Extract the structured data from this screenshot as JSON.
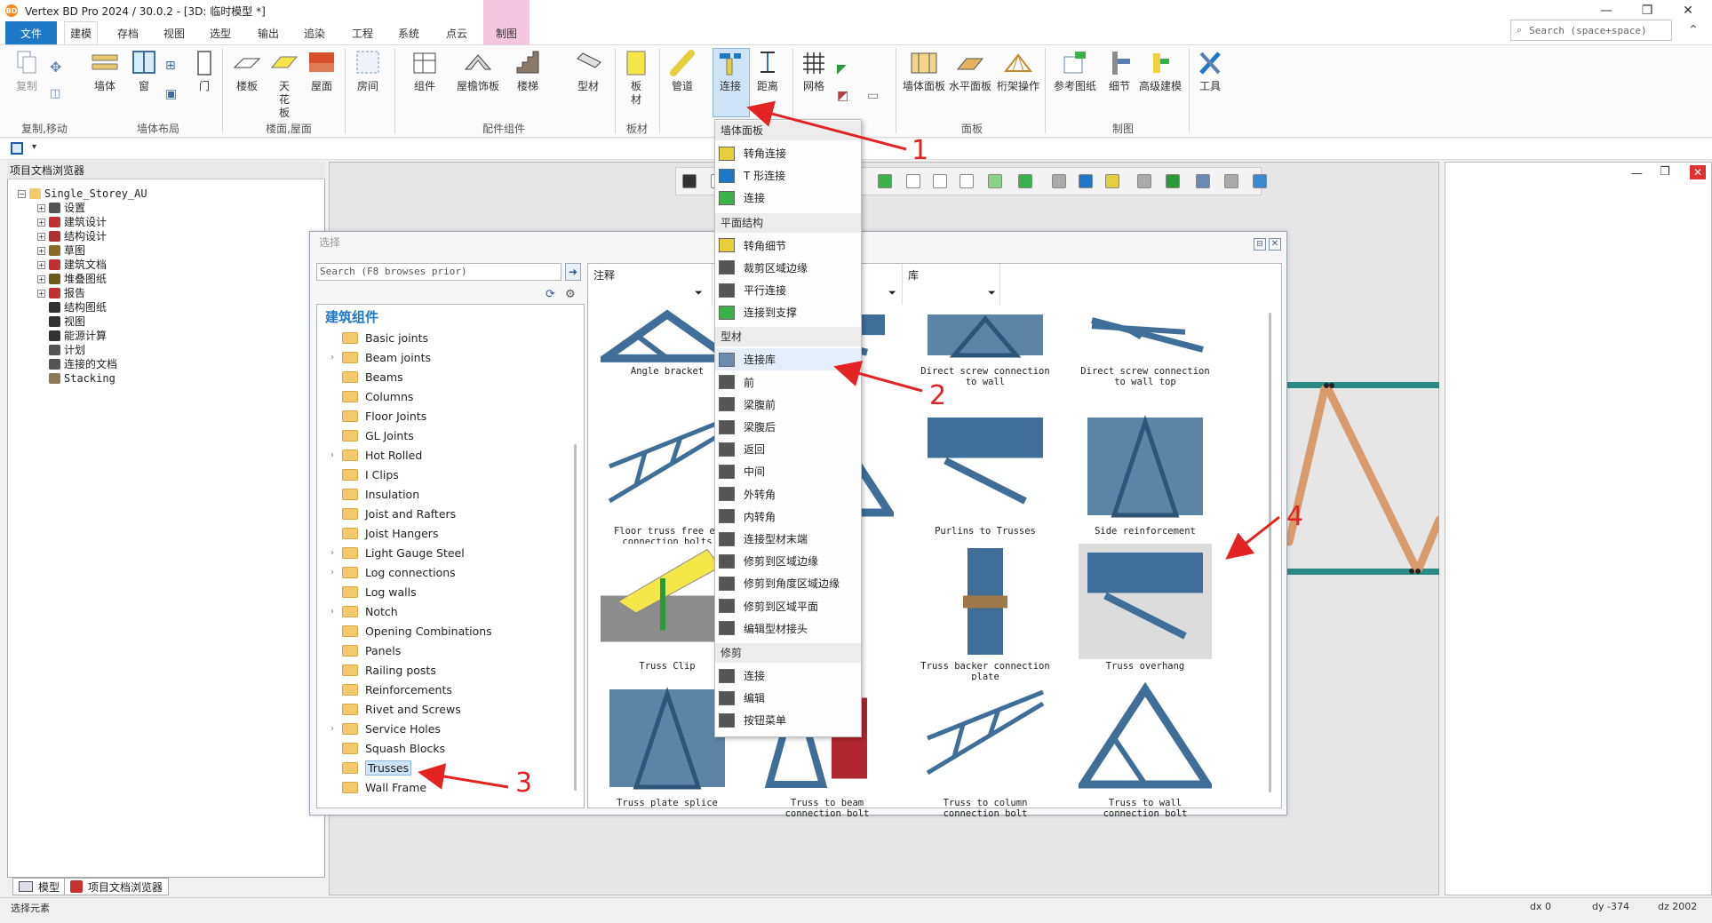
{
  "window": {
    "title": "Vertex BD Pro 2024 / 30.0.2 - [3D: 临时模型 *]",
    "minimize": "—",
    "maximize": "❐",
    "close": "✕"
  },
  "ribbon_tabs": [
    "文件",
    "建模",
    "存档",
    "视图",
    "选型",
    "输出",
    "追染",
    "工程",
    "系统",
    "点云",
    "制图"
  ],
  "search": {
    "placeholder": "Search (space+space)"
  },
  "ribbon": {
    "buttons": {
      "copy": "复制",
      "wall": "墙体",
      "window": "窗",
      "door": "门",
      "floor": "楼板",
      "ceiling": "天花板",
      "roof": "屋面",
      "room": "房间",
      "component": "组件",
      "roof_decor": "屋檐饰板",
      "stairs": "楼梯",
      "profile": "型材",
      "plate": "板材",
      "pipe": "管道",
      "connect": "连接",
      "distance": "距离",
      "grid": "网格",
      "wall_panel": "墙体面板",
      "floor_panel": "水平面板",
      "truss_ops": "桁架操作",
      "ref_drawing": "参考图纸",
      "detail": "细节",
      "adv_model": "高级建模",
      "tools": "工具"
    },
    "groups": [
      "复制,移动",
      "墙体布局",
      "楼面,屋面",
      "配件组件",
      "板材",
      "面板",
      "制图"
    ]
  },
  "left_panel": {
    "title": "项目文档浏览器",
    "tree": [
      {
        "label": "Single_Storey_AU",
        "expander": "−"
      },
      {
        "label": "设置",
        "expander": "+"
      },
      {
        "label": "建筑设计",
        "expander": "+"
      },
      {
        "label": "结构设计",
        "expander": "+"
      },
      {
        "label": "草图",
        "expander": "+"
      },
      {
        "label": "建筑文档",
        "expander": "+"
      },
      {
        "label": "堆叠图纸",
        "expander": "+"
      },
      {
        "label": "报告",
        "expander": "+"
      },
      {
        "label": "结构图纸",
        "expander": ""
      },
      {
        "label": "视图",
        "expander": ""
      },
      {
        "label": "能源计算",
        "expander": ""
      },
      {
        "label": "计划",
        "expander": ""
      },
      {
        "label": "连接的文档",
        "expander": ""
      },
      {
        "label": "Stacking",
        "expander": ""
      }
    ],
    "bottom_tabs": [
      "模型",
      "项目文档浏览器"
    ]
  },
  "dialog": {
    "title": "选择",
    "search_placeholder": "Search (F8 browses prior)",
    "category_title": "建筑组件",
    "columns": [
      "注释",
      "库"
    ],
    "folders": [
      {
        "label": "Basic joints",
        "expandable": false
      },
      {
        "label": "Beam joints",
        "expandable": true
      },
      {
        "label": "Beams",
        "expandable": false
      },
      {
        "label": "Columns",
        "expandable": false
      },
      {
        "label": "Floor Joints",
        "expandable": false
      },
      {
        "label": "GL Joints",
        "expandable": false
      },
      {
        "label": "Hot Rolled",
        "expandable": true
      },
      {
        "label": "I Clips",
        "expandable": false
      },
      {
        "label": "Insulation",
        "expandable": false
      },
      {
        "label": "Joist and Rafters",
        "expandable": false
      },
      {
        "label": "Joist Hangers",
        "expandable": false
      },
      {
        "label": "Light Gauge Steel",
        "expandable": true
      },
      {
        "label": "Log connections",
        "expandable": true
      },
      {
        "label": "Log walls",
        "expandable": false
      },
      {
        "label": "Notch",
        "expandable": true
      },
      {
        "label": "Opening Combinations",
        "expandable": false
      },
      {
        "label": "Panels",
        "expandable": false
      },
      {
        "label": "Railing posts",
        "expandable": false
      },
      {
        "label": "Reinforcements",
        "expandable": false
      },
      {
        "label": "Rivet and Screws",
        "expandable": false
      },
      {
        "label": "Service Holes",
        "expandable": true
      },
      {
        "label": "Squash Blocks",
        "expandable": false
      },
      {
        "label": "Trusses",
        "expandable": false,
        "selected": true
      },
      {
        "label": "Wall Frame",
        "expandable": false
      }
    ],
    "thumbnails": [
      {
        "caption": "Angle bracket"
      },
      {
        "caption": "ation"
      },
      {
        "caption": "Direct screw connection to wall"
      },
      {
        "caption": "Direct screw connection to wall top"
      },
      {
        "caption": "Floor truss free en connection bolts"
      },
      {
        "caption": "ger"
      },
      {
        "caption": "Purlins to Trusses"
      },
      {
        "caption": "Side reinforcement"
      },
      {
        "caption": "Truss Clip"
      },
      {
        "caption": ""
      },
      {
        "caption": "Truss backer connection plate"
      },
      {
        "caption": "Truss overhang",
        "selected": true
      },
      {
        "caption": "Truss plate splice"
      },
      {
        "caption": "Truss to beam connection bolt"
      },
      {
        "caption": "Truss to column connection bolt"
      },
      {
        "caption": "Truss to wall connection bolt"
      }
    ]
  },
  "menu": {
    "sections": [
      {
        "header": "墙体面板",
        "items": [
          "转角连接",
          "T 形连接",
          "连接"
        ]
      },
      {
        "header": "平面结构",
        "items": [
          "转角细节",
          "裁剪区域边缘",
          "平行连接",
          "连接到支撑"
        ]
      },
      {
        "header": "型材",
        "items": [
          "连接库",
          "前",
          "梁腹前",
          "梁腹后",
          "返回",
          "中间",
          "外转角",
          "内转角",
          "连接型材末端",
          "修剪到区域边缘",
          "修剪到角度区域边缘",
          "修剪到区域平面",
          "编辑型材接头"
        ]
      },
      {
        "header": "修剪",
        "items": [
          "连接",
          "编辑",
          "按钮菜单"
        ]
      }
    ]
  },
  "status": {
    "left": "选择元素",
    "dx": "dx 0",
    "dy": "dy -374",
    "dz": "dz 2002"
  },
  "annotations": [
    "1",
    "2",
    "3",
    "4"
  ],
  "colors": {
    "accent": "#1e78c8",
    "arrow": "#e32222",
    "truss_steel": "#3f6f98",
    "truss_timber": "#d99a6c",
    "truss_chord": "#2c8a84"
  }
}
